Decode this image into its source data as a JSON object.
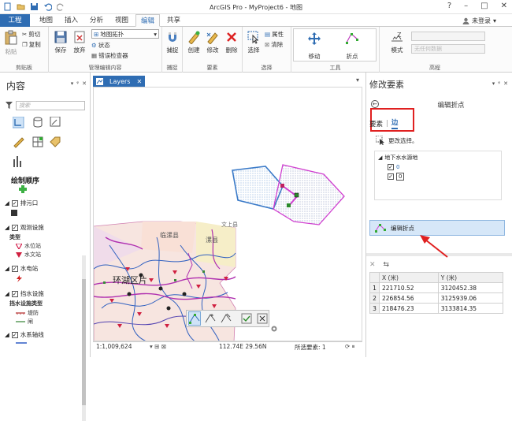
{
  "window": {
    "title": "ArcGIS Pro - MyProject6 - 地图"
  },
  "tabs": [
    {
      "label": "工程"
    },
    {
      "label": "地图"
    },
    {
      "label": "插入"
    },
    {
      "label": "分析"
    },
    {
      "label": "视图"
    },
    {
      "label": "编辑"
    },
    {
      "label": "共享"
    }
  ],
  "signin": "未登录",
  "ribbon": {
    "clipboard": {
      "paste": "粘贴",
      "cut": "剪切",
      "copy": "复制",
      "label": "剪贴板"
    },
    "manage": {
      "save": "保存",
      "discard": "放弃",
      "dropdown": "地图拓扑",
      "status": "状态",
      "error_inspector": "错误检查器",
      "label": "管理编辑内容"
    },
    "snapping": {
      "snap": "捕捉",
      "label": "捕捉"
    },
    "features": {
      "create": "创建",
      "modify": "修改",
      "delete": "删除",
      "label": "要素"
    },
    "selection": {
      "select": "选择",
      "attributes": "属性",
      "clear": "清除",
      "label": "选择"
    },
    "tools": {
      "move": "移动",
      "vertices": "折点",
      "label": "工具"
    },
    "elevation": {
      "mode": "模式",
      "constant_placeholder": "无任何数据",
      "label": "高程"
    }
  },
  "contents": {
    "title": "内容",
    "search_placeholder": "搜索",
    "draw_order": "绘制顺序",
    "layers": [
      {
        "label": "排污口",
        "checked": true
      },
      {
        "label": "观测设施",
        "checked": true
      },
      {
        "label": "水电站",
        "checked": true
      },
      {
        "label": "挡水设施",
        "checked": true
      },
      {
        "label": "水系轴线",
        "checked": true
      }
    ],
    "type_label": "类型",
    "legend_station1": "水位站",
    "legend_station2": "水文站",
    "type_label2": "挡水设施类型",
    "legend_dyke": "堤防",
    "legend_gate": "闸"
  },
  "map": {
    "tab": "Layers",
    "labels": {
      "linyi": "临漯县",
      "luo": "漯县",
      "huanhu": "环湖区片",
      "wenshang": "文上县"
    },
    "scale": "1:1,009,624",
    "coords": "112.74E 29.56N",
    "selected": "所选要素: 1"
  },
  "modify": {
    "title": "修改要素",
    "tool_name": "编辑折点",
    "tab_feature": "要素",
    "tab_edge": "边",
    "change_selection": "更改选择。",
    "tree_layer": "地下水水源地",
    "tree_item1": "0",
    "tree_item2": "0",
    "selected_tool": "编辑折点",
    "table": {
      "headers": [
        "",
        "X (米)",
        "Y (米)"
      ],
      "rows": [
        {
          "idx": "1",
          "x": "221710.52",
          "y": "3120452.38"
        },
        {
          "idx": "2",
          "x": "226854.56",
          "y": "3125939.06"
        },
        {
          "idx": "3",
          "x": "218476.23",
          "y": "3133814.35"
        }
      ]
    }
  },
  "colors": {
    "accent": "#2f6db3",
    "highlight_red": "#e02020",
    "selection_cyan": "#00c0ff",
    "magenta": "#d040d0"
  }
}
